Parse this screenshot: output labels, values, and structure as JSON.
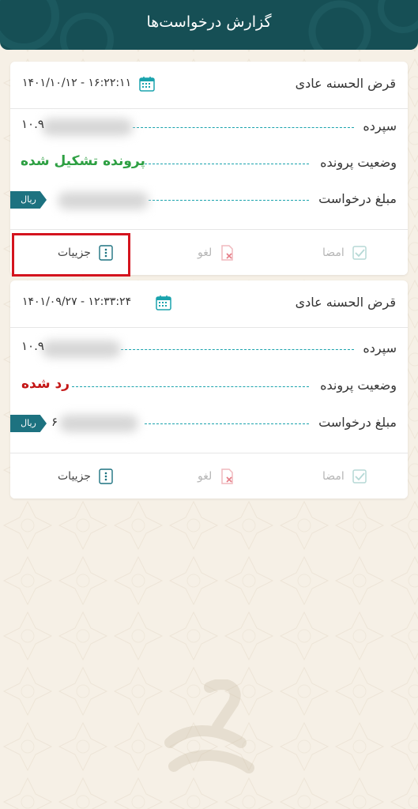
{
  "header": {
    "title": "گزارش درخواست‌ها"
  },
  "cards": [
    {
      "type": "قرض الحسنه عادی",
      "datetime": "۱۴۰۱/۱۰/۱۲ - ۱۶:۲۲:۱۱",
      "deposit_label": "سپرده",
      "deposit_value": "۱۰.۹",
      "status_label": "وضعیت پرونده",
      "status_value": "پرونده تشکیل شده",
      "amount_label": "مبلغ درخواست",
      "currency": "ریال",
      "actions": {
        "sign": "امضا",
        "cancel": "لغو",
        "details": "جزییات"
      }
    },
    {
      "type": "قرض الحسنه عادی",
      "datetime": "۱۴۰۱/۰۹/۲۷ - ۱۲:۳۳:۲۴",
      "deposit_label": "سپرده",
      "deposit_value": "۱۰.۹",
      "status_label": "وضعیت پرونده",
      "status_value": "رد شده",
      "amount_label": "مبلغ درخواست",
      "amount_value": "۶",
      "currency": "ریال",
      "actions": {
        "sign": "امضا",
        "cancel": "لغو",
        "details": "جزییات"
      }
    }
  ],
  "colors": {
    "header_bg": "#164f55",
    "accent_teal": "#1d7280",
    "status_success": "#2ea043",
    "status_rejected": "#c41717",
    "highlight": "#d4141e"
  },
  "icons": {
    "calendar": "calendar-icon",
    "sign": "check-square-icon",
    "cancel": "cancel-document-icon",
    "details": "more-vertical-icon"
  }
}
